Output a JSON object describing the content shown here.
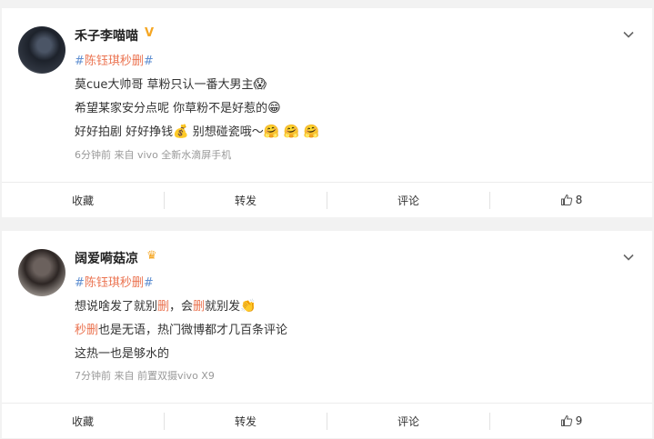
{
  "posts": [
    {
      "username": "禾子李喵喵",
      "badge": "V",
      "topic": {
        "hash_open": "#",
        "text": "陈钰琪秒删",
        "hash_close": "#"
      },
      "lines": [
        {
          "text": "莫cue大帅哥 草粉只认一番大男主",
          "emoji": "😱"
        },
        {
          "text": "希望某家安分点呢 你草粉不是好惹的",
          "emoji": "😁"
        },
        {
          "text": "好好拍剧 好好挣钱",
          "emoji_mid": "💰",
          "text2": " 别想碰瓷哦～",
          "emoji_end": "🤗 🤗 🤗"
        }
      ],
      "meta": "6分钟前   来自 vivo 全新水滴屏手机",
      "actions": {
        "favorite": "收藏",
        "repost": "转发",
        "comment": "评论",
        "like_count": "8"
      }
    },
    {
      "username": "阔爱嗬菇凉",
      "badge": "♛",
      "topic": {
        "hash_open": "#",
        "text": "陈钰琪秒删",
        "hash_close": "#"
      },
      "line1": {
        "a": "想说啥发了就别",
        "b": "删",
        "c": "，会",
        "d": "删",
        "e": "就别发",
        "emoji": "👏"
      },
      "line2": {
        "a": "秒删",
        "b": "也是无语，热门微博都才几百条评论"
      },
      "line3": "这热一也是够水的",
      "meta": "7分钟前   来自 前置双摄vivo X9",
      "actions": {
        "favorite": "收藏",
        "repost": "转发",
        "comment": "评论",
        "like_count": "9"
      }
    }
  ]
}
